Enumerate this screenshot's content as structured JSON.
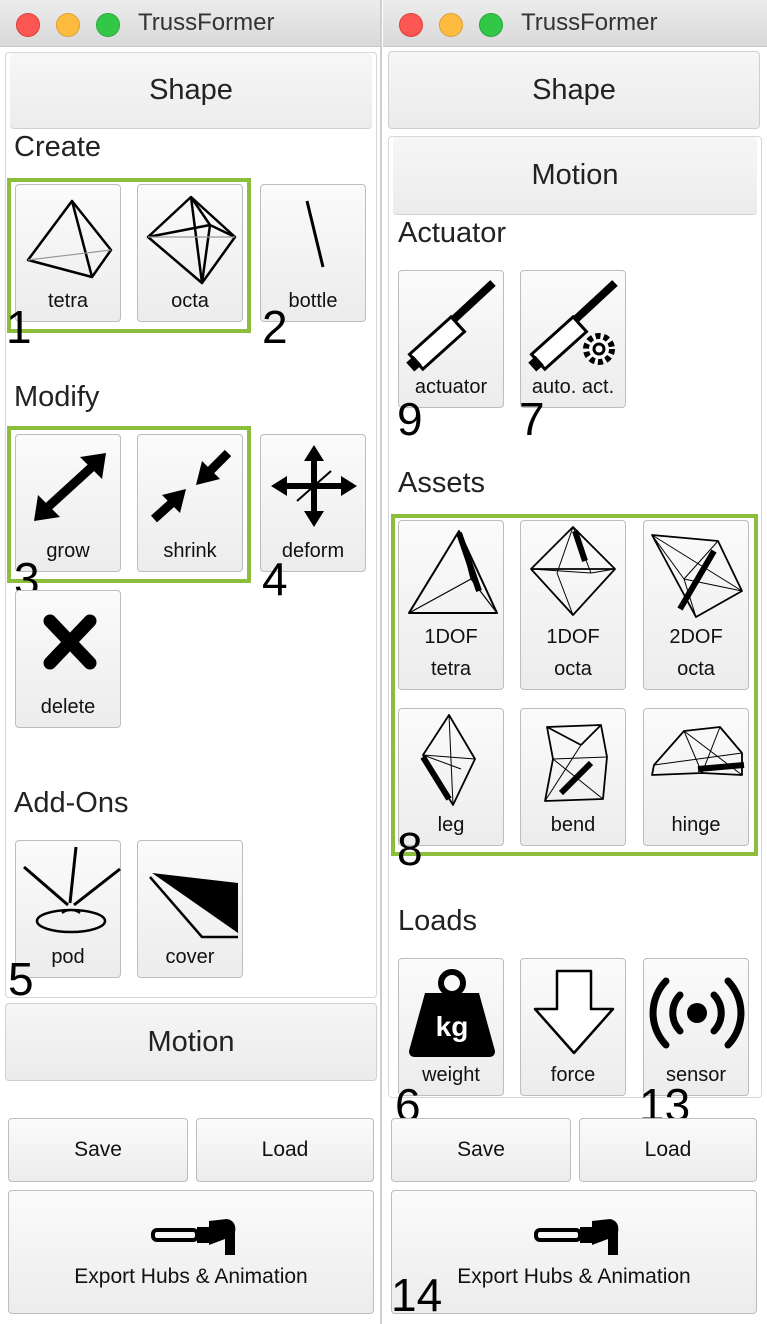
{
  "app_title": "TrussFormer",
  "left": {
    "shape_tab": "Shape",
    "create_header": "Create",
    "create_buttons": [
      "tetra",
      "octa",
      "bottle"
    ],
    "modify_header": "Modify",
    "modify_buttons": [
      "grow",
      "shrink",
      "deform",
      "delete"
    ],
    "addons_header": "Add-Ons",
    "addon_buttons": [
      "pod",
      "cover"
    ],
    "motion_tab": "Motion",
    "save": "Save",
    "load": "Load",
    "export": "Export Hubs & Animation"
  },
  "right": {
    "shape_tab": "Shape",
    "motion_tab": "Motion",
    "actuator_header": "Actuator",
    "actuator_buttons": [
      "actuator",
      "auto. act."
    ],
    "assets_header": "Assets",
    "asset_buttons": [
      {
        "line1": "1DOF",
        "line2": "tetra"
      },
      {
        "line1": "1DOF",
        "line2": "octa"
      },
      {
        "line1": "2DOF",
        "line2": "octa"
      },
      {
        "line1": "leg",
        "line2": ""
      },
      {
        "line1": "bend",
        "line2": ""
      },
      {
        "line1": "hinge",
        "line2": ""
      }
    ],
    "loads_header": "Loads",
    "load_buttons": [
      "weight",
      "force",
      "sensor"
    ],
    "weight_glyph": "kg",
    "save": "Save",
    "load": "Load",
    "export": "Export Hubs & Animation"
  },
  "annotations": [
    "1",
    "2",
    "3",
    "4",
    "5",
    "6",
    "7",
    "8",
    "9",
    "13",
    "14"
  ],
  "colors": {
    "highlight_green": "#8cbe3c",
    "close_red": "#fc5753",
    "minimize_yellow": "#fdbc40",
    "zoom_green": "#33c748"
  }
}
